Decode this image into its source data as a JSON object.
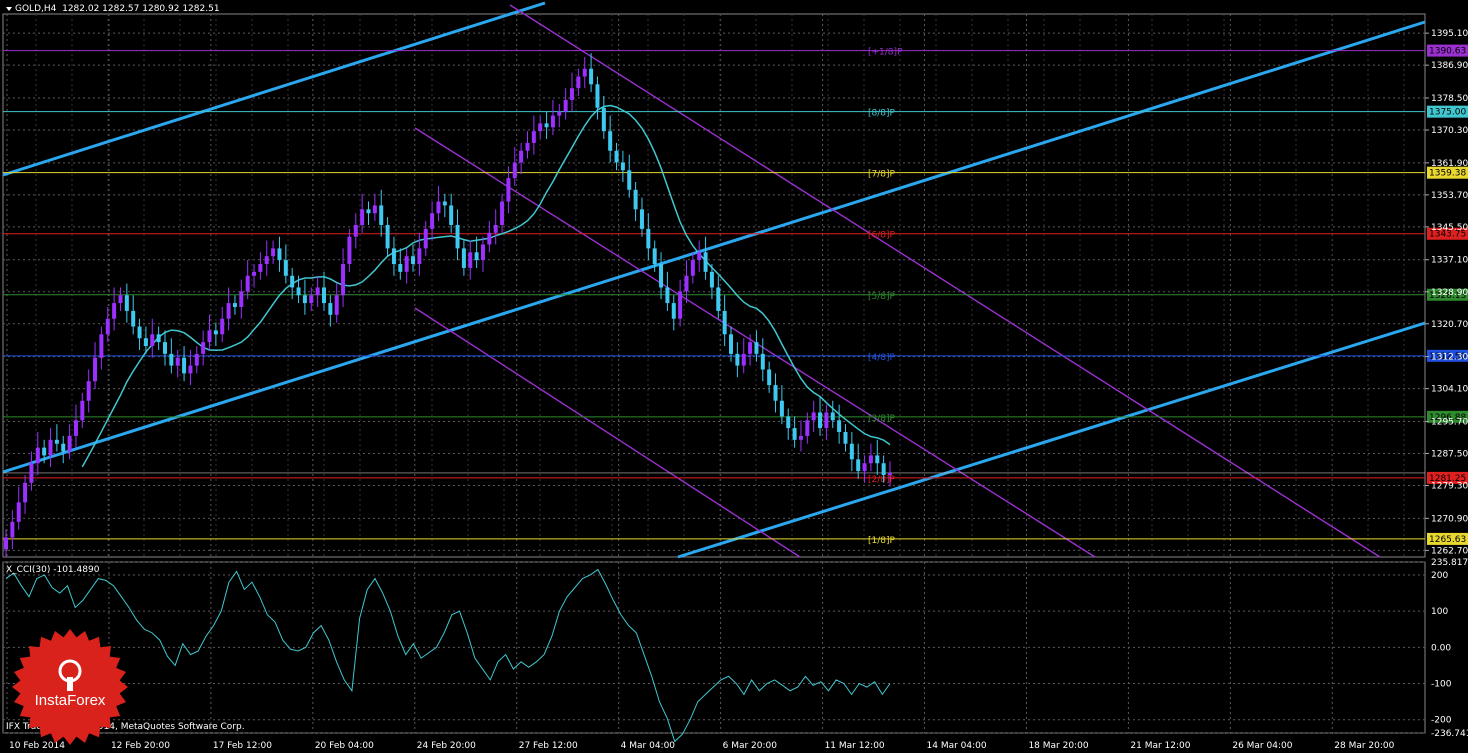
{
  "header": {
    "symbol": "GOLD,H4",
    "ohlc": "1282.02 1282.57 1280.92 1282.51"
  },
  "indicator": {
    "title": "X_CCI(30) -101.4890"
  },
  "copyright": "IFX Trader © 2001-2014, MetaQuotes Software Corp.",
  "logo": {
    "text": "InstaForex"
  },
  "colors": {
    "background": "#000000",
    "grid": "#5a5a5a",
    "bull_candle": "#9b30ff",
    "bear_candle": "#3fc9f0",
    "ma_line": "#40c8d0",
    "channel_blue": "#2aa7ef",
    "channel_purple": "#9b30d0",
    "cci_line": "#40c8d0",
    "logo_red": "#d9221c"
  },
  "chart_data": [
    {
      "type": "candlestick",
      "title": "GOLD,H4",
      "x_tick_labels": [
        "10 Feb 2014",
        "12 Feb 20:00",
        "17 Feb 12:00",
        "20 Feb 04:00",
        "24 Feb 20:00",
        "27 Feb 12:00",
        "4 Mar 04:00",
        "6 Mar 20:00",
        "11 Mar 12:00",
        "14 Mar 04:00",
        "18 Mar 20:00",
        "21 Mar 12:00",
        "26 Mar 04:00",
        "28 Mar 20:00"
      ],
      "y_tick_labels": [
        "1395.10",
        "1386.90",
        "1378.50",
        "1370.30",
        "1361.90",
        "1353.70",
        "1345.50",
        "1337.10",
        "1328.90",
        "1320.70",
        "1312.30",
        "1304.10",
        "1295.70",
        "1287.50",
        "1279.30",
        "1270.90",
        "1262.70"
      ],
      "ylim": [
        1261.0,
        1400.0
      ],
      "current_price": "1282.51",
      "murrey_levels": [
        {
          "label": "[+1/8]P",
          "value": 1390.63,
          "price_label": "1390.63",
          "color": "#9b30d0"
        },
        {
          "label": "[8/8]P",
          "value": 1375.0,
          "price_label": "1375.00",
          "color": "#40c8d0"
        },
        {
          "label": "[7/8]P",
          "value": 1359.38,
          "price_label": "1359.38",
          "color": "#e8d830"
        },
        {
          "label": "[6/8]P",
          "value": 1343.75,
          "price_label": "1343.75",
          "color": "#e02020"
        },
        {
          "label": "[5/8]P",
          "value": 1328.13,
          "price_label": "1328.13",
          "color": "#2e8b2e"
        },
        {
          "label": "[4/8]P",
          "value": 1312.5,
          "price_label": "1312.50",
          "color": "#2050e0"
        },
        {
          "label": "[3/8]P",
          "value": 1296.88,
          "price_label": "1296.88",
          "color": "#2e8b2e"
        },
        {
          "label": "[2/8]P",
          "value": 1281.25,
          "price_label": "1281.25",
          "color": "#e02020"
        },
        {
          "label": "[1/8]P",
          "value": 1265.63,
          "price_label": "1265.63",
          "color": "#e8d830"
        }
      ],
      "close_series": [
        1266,
        1270,
        1275,
        1280,
        1285,
        1289,
        1287,
        1291,
        1290,
        1288,
        1292,
        1296,
        1301,
        1306,
        1312,
        1318,
        1322,
        1326,
        1328,
        1324,
        1320,
        1317,
        1315,
        1318,
        1316,
        1313,
        1310,
        1312,
        1308,
        1310,
        1313,
        1316,
        1319,
        1318,
        1322,
        1326,
        1325,
        1329,
        1333,
        1334,
        1336,
        1338,
        1340,
        1337,
        1333,
        1330,
        1328,
        1326,
        1328,
        1330,
        1326,
        1323,
        1328,
        1336,
        1343,
        1346,
        1350,
        1349,
        1351,
        1346,
        1340,
        1336,
        1334,
        1338,
        1336,
        1340,
        1345,
        1349,
        1352,
        1351,
        1346,
        1340,
        1335,
        1339,
        1337,
        1341,
        1344,
        1346,
        1352,
        1358,
        1362,
        1365,
        1367,
        1370,
        1372,
        1371,
        1374,
        1375,
        1378,
        1381,
        1384,
        1386,
        1382,
        1376,
        1370,
        1365,
        1362,
        1360,
        1355,
        1350,
        1345,
        1340,
        1336,
        1330,
        1326,
        1322,
        1329,
        1333,
        1337,
        1339,
        1334,
        1330,
        1324,
        1318,
        1313,
        1310,
        1313,
        1316,
        1313,
        1309,
        1305,
        1301,
        1297,
        1294,
        1291,
        1292,
        1296,
        1298,
        1294,
        1298,
        1296,
        1293,
        1290,
        1286,
        1283,
        1285,
        1287,
        1285,
        1282,
        1282.5
      ]
    },
    {
      "type": "line",
      "title": "X_CCI(30) -101.4890",
      "y_tick_labels": [
        "235.8172",
        "200",
        "100",
        "0.00",
        "-100",
        "-200",
        "-236.7419"
      ],
      "ylim": [
        -236.7419,
        235.8172
      ],
      "values": [
        190,
        205,
        170,
        140,
        190,
        200,
        165,
        150,
        170,
        110,
        130,
        160,
        190,
        185,
        170,
        140,
        110,
        75,
        50,
        40,
        20,
        -25,
        -50,
        10,
        -20,
        -10,
        30,
        60,
        100,
        180,
        210,
        160,
        180,
        140,
        90,
        70,
        20,
        -5,
        -10,
        0,
        40,
        60,
        20,
        -40,
        -90,
        -120,
        80,
        160,
        190,
        150,
        100,
        30,
        -20,
        10,
        -30,
        -15,
        0,
        40,
        90,
        100,
        40,
        -30,
        -60,
        -90,
        -40,
        -20,
        -60,
        -40,
        -55,
        -40,
        -20,
        30,
        100,
        140,
        165,
        190,
        200,
        215,
        175,
        130,
        90,
        60,
        40,
        -20,
        -80,
        -150,
        -195,
        -260,
        -240,
        -200,
        -150,
        -130,
        -110,
        -90,
        -80,
        -100,
        -130,
        -90,
        -120,
        -100,
        -90,
        -105,
        -120,
        -110,
        -80,
        -105,
        -95,
        -120,
        -90,
        -100,
        -130,
        -100,
        -110,
        -95,
        -130,
        -100
      ]
    }
  ]
}
